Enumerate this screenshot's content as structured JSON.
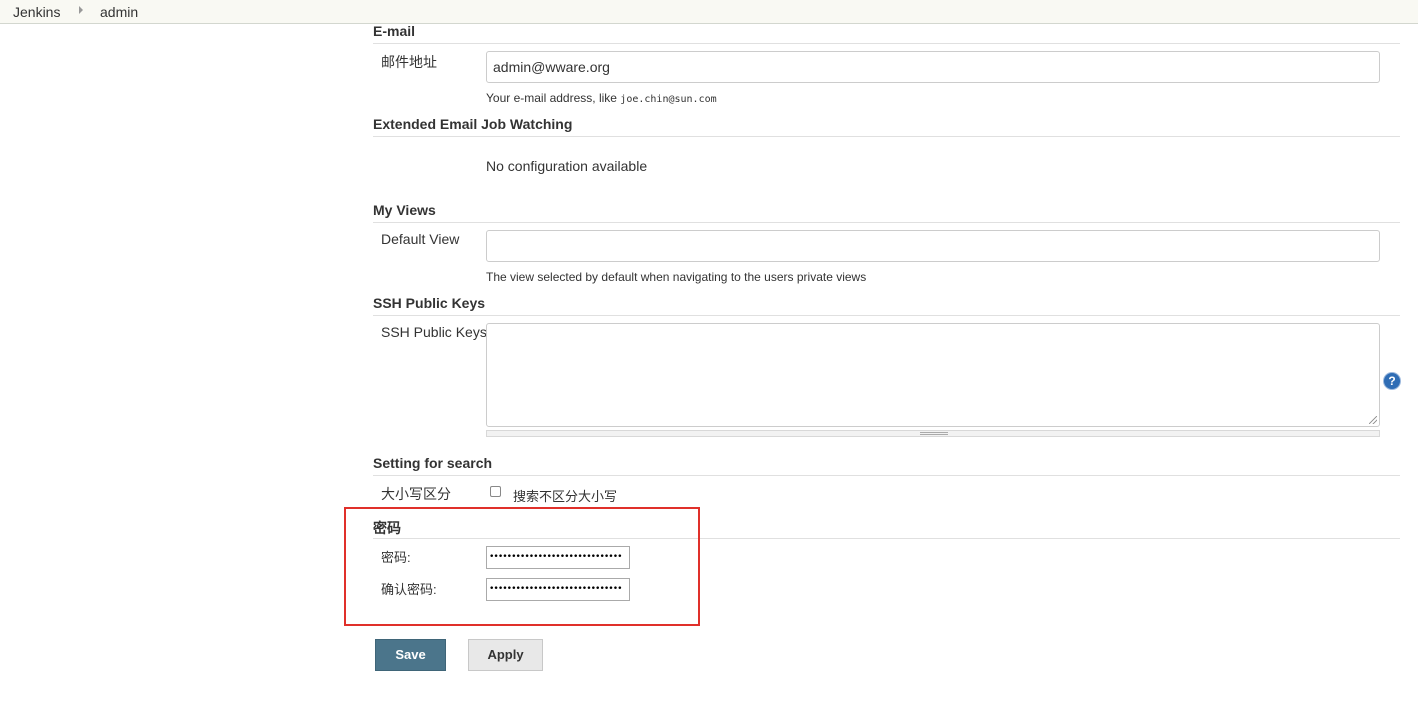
{
  "breadcrumb": {
    "items": [
      "Jenkins",
      "admin"
    ]
  },
  "email": {
    "section_title": "E-mail",
    "label": "邮件地址",
    "value": "admin@wware.org",
    "help_prefix": "Your e-mail address, like ",
    "help_example": "joe.chin@sun.com"
  },
  "extended_email": {
    "section_title": "Extended Email Job Watching",
    "message": "No configuration available"
  },
  "my_views": {
    "section_title": "My Views",
    "label": "Default View",
    "value": "",
    "help": "The view selected by default when navigating to the users private views"
  },
  "ssh": {
    "section_title": "SSH Public Keys",
    "label": "SSH Public Keys",
    "value": "",
    "help_icon": "?"
  },
  "search": {
    "section_title": "Setting for search",
    "label": "大小写区分",
    "checkbox_label": "搜索不区分大小写",
    "checked": false
  },
  "password": {
    "section_title": "密码",
    "label": "密码:",
    "confirm_label": "确认密码:",
    "masked_value": "••••••••••••••••••••••••••••••",
    "masked_confirm": "••••••••••••••••••••••••••••••"
  },
  "buttons": {
    "save": "Save",
    "apply": "Apply"
  },
  "colors": {
    "highlight": "#e0302a",
    "save_bg": "#4b758b",
    "help_icon": "#2f6db5"
  }
}
